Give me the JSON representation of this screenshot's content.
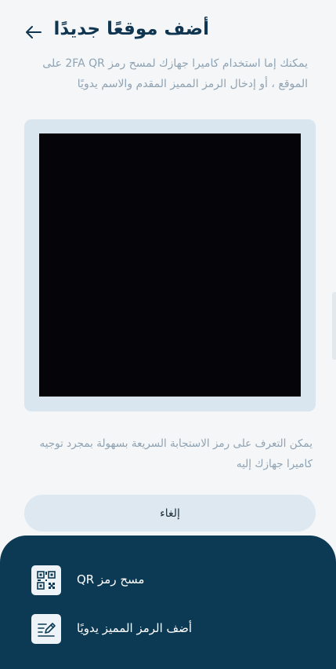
{
  "header": {
    "title": "أضف موقعًا جديدًا",
    "back_icon": "arrow-left-icon"
  },
  "description": "يمكنك إما استخدام كاميرا جهازك لمسح رمز 2FA QR على الموقع ، أو إدخال الرمز المميز المقدم والاسم يدويًا",
  "hint": "يمكن التعرف على رمز الاستجابة السريعة بسهولة بمجرد توجيه كاميرا جهازك إليه",
  "cancel_label": "إلغاء",
  "sheet": {
    "items": [
      {
        "label": "مسح رمز QR",
        "icon": "qr-code-icon"
      },
      {
        "label": "أضف الرمز المميز يدويًا",
        "icon": "edit-document-icon"
      }
    ]
  },
  "colors": {
    "primary_dark": "#0c3a54",
    "title": "#0f3550",
    "muted_text": "#8fa3b3",
    "card_bg": "#dae6ef",
    "button_bg": "#dde8f0"
  }
}
